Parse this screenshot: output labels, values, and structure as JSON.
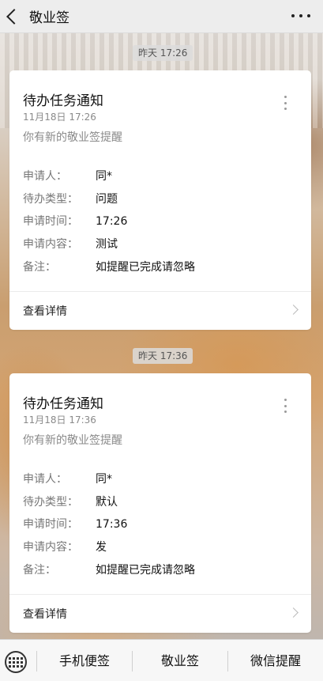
{
  "topbar": {
    "title": "敬业签"
  },
  "messages": [
    {
      "timestamp": "昨天 17:26",
      "title": "待办任务通知",
      "date": "11月18日  17:26",
      "desc": "你有新的敬业签提醒",
      "fields": [
        {
          "label": "申请人：",
          "value": "同*"
        },
        {
          "label": "待办类型：",
          "value": "问题"
        },
        {
          "label": "申请时间：",
          "value": "17:26"
        },
        {
          "label": "申请内容：",
          "value": "测试"
        },
        {
          "label": "备注：",
          "value": "如提醒已完成请忽略"
        }
      ],
      "detail_label": "查看详情"
    },
    {
      "timestamp": "昨天 17:36",
      "title": "待办任务通知",
      "date": "11月18日  17:36",
      "desc": "你有新的敬业签提醒",
      "fields": [
        {
          "label": "申请人：",
          "value": "同*"
        },
        {
          "label": "待办类型：",
          "value": "默认"
        },
        {
          "label": "申请时间：",
          "value": "17:36"
        },
        {
          "label": "申请内容：",
          "value": "发"
        },
        {
          "label": "备注：",
          "value": "如提醒已完成请忽略"
        }
      ],
      "detail_label": "查看详情"
    }
  ],
  "bottom_menu": {
    "items": [
      "手机便签",
      "敬业签",
      "微信提醒"
    ]
  },
  "colors": {
    "topbar_bg": "#ededed",
    "card_bg": "#ffffff",
    "value_text": "#111111",
    "label_text": "#777777"
  }
}
